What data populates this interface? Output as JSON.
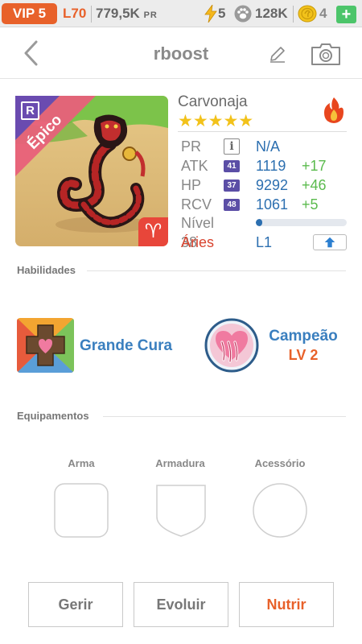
{
  "status_bar": {
    "vip": "VIP 5",
    "level": "L70",
    "pr_value": "779,5K",
    "pr_unit": "PR",
    "energy": "5",
    "paw_count": "128K",
    "coins": "4",
    "add_label": "+"
  },
  "header": {
    "title": "rboost",
    "icons": [
      "chevron-left-icon",
      "pencil-icon",
      "camera-icon"
    ]
  },
  "monster": {
    "name": "Carvonaja",
    "rarity": "Épico",
    "rank_badge": "R",
    "zodiac_symbol": "♈",
    "stars": "★★★★★",
    "star_count": 5,
    "element_icon": "fire-icon",
    "colors": {
      "rarity_band": "#e8607a",
      "zodiac_badge": "#e8463a",
      "stat_value": "#2c6fb0",
      "bonus": "#5bbb4e"
    },
    "stats": [
      {
        "label": "PR",
        "badge": "i",
        "value": "N/A",
        "bonus": ""
      },
      {
        "label": "ATK",
        "badge": "41",
        "value": "1119",
        "bonus": "+17"
      },
      {
        "label": "HP",
        "badge": "37",
        "value": "9292",
        "bonus": "+46"
      },
      {
        "label": "RCV",
        "badge": "48",
        "value": "1061",
        "bonus": "+5"
      }
    ],
    "level_label": "Nível 38",
    "level_progress": 0.07,
    "sign_label": "Áries",
    "sign_level": "L1"
  },
  "skills": {
    "title": "Habilidades",
    "items": [
      {
        "name": "Grande Cura",
        "level": ""
      },
      {
        "name": "Campeão",
        "level": "LV 2"
      }
    ]
  },
  "equipment": {
    "title": "Equipamentos",
    "slots": [
      "Arma",
      "Armadura",
      "Acessório"
    ]
  },
  "actions": {
    "manage": "Gerir",
    "evolve": "Evoluir",
    "feed": "Nutrir"
  }
}
